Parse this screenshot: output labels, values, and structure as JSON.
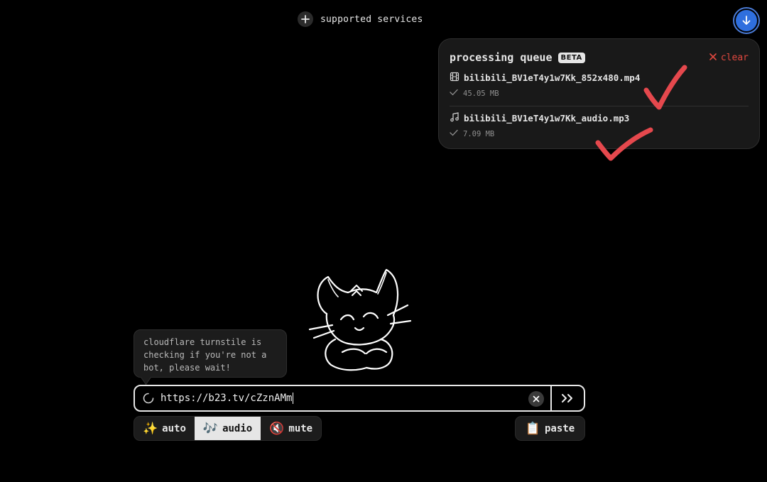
{
  "header": {
    "services_label": "supported services"
  },
  "queue": {
    "title": "processing queue",
    "badge": "BETA",
    "clear_label": "clear",
    "items": [
      {
        "icon": "film-icon",
        "filename": "bilibili_BV1eT4y1w7Kk_852x480.mp4",
        "size": "45.05 MB",
        "status": "done"
      },
      {
        "icon": "music-note-icon",
        "filename": "bilibili_BV1eT4y1w7Kk_audio.mp3",
        "size": "7.09 MB",
        "status": "done"
      }
    ]
  },
  "tooltip": {
    "text": "cloudflare turnstile is checking if you're not a bot, please wait!"
  },
  "input": {
    "value": "https://b23.tv/cZznAMm"
  },
  "modes": {
    "selected": "audio",
    "items": [
      {
        "emoji": "✨",
        "label": "auto"
      },
      {
        "emoji": "🎶",
        "label": "audio"
      },
      {
        "emoji": "🔇",
        "label": "mute"
      }
    ]
  },
  "paste": {
    "emoji": "📋",
    "label": "paste"
  },
  "colors": {
    "accent_blue": "#2f6fde",
    "danger_red": "#e0483f",
    "annotation_red": "#e5484d"
  }
}
